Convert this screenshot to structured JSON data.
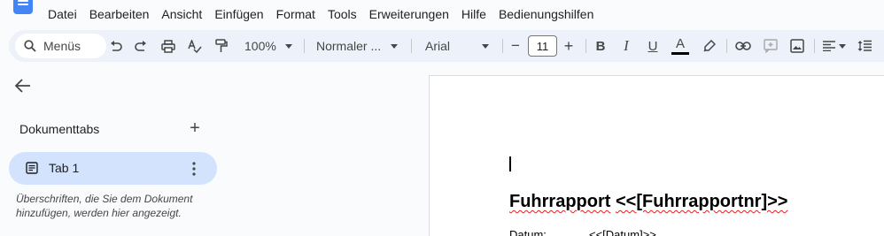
{
  "menu": {
    "items": [
      "Datei",
      "Bearbeiten",
      "Ansicht",
      "Einfügen",
      "Format",
      "Tools",
      "Erweiterungen",
      "Hilfe",
      "Bedienungshilfen"
    ]
  },
  "toolbar": {
    "search_label": "Menüs",
    "zoom": "100%",
    "style": "Normaler ...",
    "font": "Arial",
    "font_size": "11",
    "bold_glyph": "B",
    "italic_glyph": "I",
    "underline_glyph": "U",
    "text_color_glyph": "A",
    "minus_glyph": "−",
    "plus_glyph": "+"
  },
  "sidebar": {
    "tabs_heading": "Dokumenttabs",
    "add_glyph": "+",
    "tab1_label": "Tab 1",
    "hint": "Überschriften, die Sie dem Dokument hinzufügen, werden hier angezeigt."
  },
  "document": {
    "heading_title": "Fuhrrapport",
    "heading_placeholder": "<<[Fuhrrapportnr]>>",
    "line2_label": "Datum:",
    "line2_value": "<<[Datum]>>"
  },
  "colors": {
    "accent": "#4285f4",
    "toolbar_bg": "#edf2fa",
    "tab_selected": "#d3e3fd",
    "spell_underline": "#e02020"
  }
}
